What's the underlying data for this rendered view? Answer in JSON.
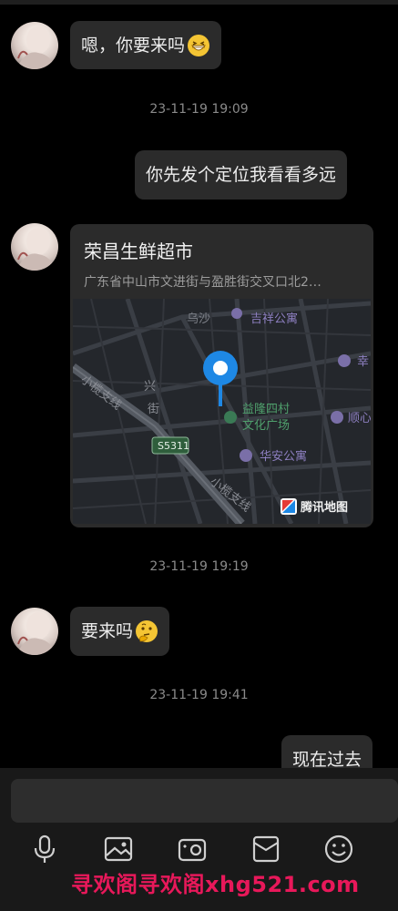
{
  "messages": [
    {
      "from": "other",
      "text": "嗯，你要来吗"
    },
    {
      "timestamp": "23-11-19 19:09"
    },
    {
      "from": "me",
      "text": "你先发个定位我看看多远"
    },
    {
      "from": "other",
      "type": "location"
    },
    {
      "timestamp": "23-11-19 19:19"
    },
    {
      "from": "other",
      "text": "要来吗"
    },
    {
      "timestamp": "23-11-19 19:41"
    },
    {
      "from": "me",
      "text": "现在过去"
    }
  ],
  "location_card": {
    "title": "荣昌生鲜超市",
    "address": "广东省中山市文进街与盈胜街交叉口北2…",
    "map_labels": {
      "wusha": "乌沙",
      "jixiang": "吉祥公寓",
      "xingfu": "兴",
      "jie": "街",
      "xiaolan": "小榄支线",
      "yilong1": "益隆四村",
      "yilong2": "文化广场",
      "s5311": "S5311",
      "huaan": "华安公寓",
      "shun": "顺心",
      "xing2": "幸",
      "road2": "小榄支线",
      "provider": "腾讯地图"
    }
  },
  "toolbar": {
    "icons": [
      "microphone-icon",
      "image-icon",
      "camera-icon",
      "card-icon",
      "emoji-icon"
    ]
  },
  "watermark": "寻欢阁寻欢阁xhg521.com"
}
